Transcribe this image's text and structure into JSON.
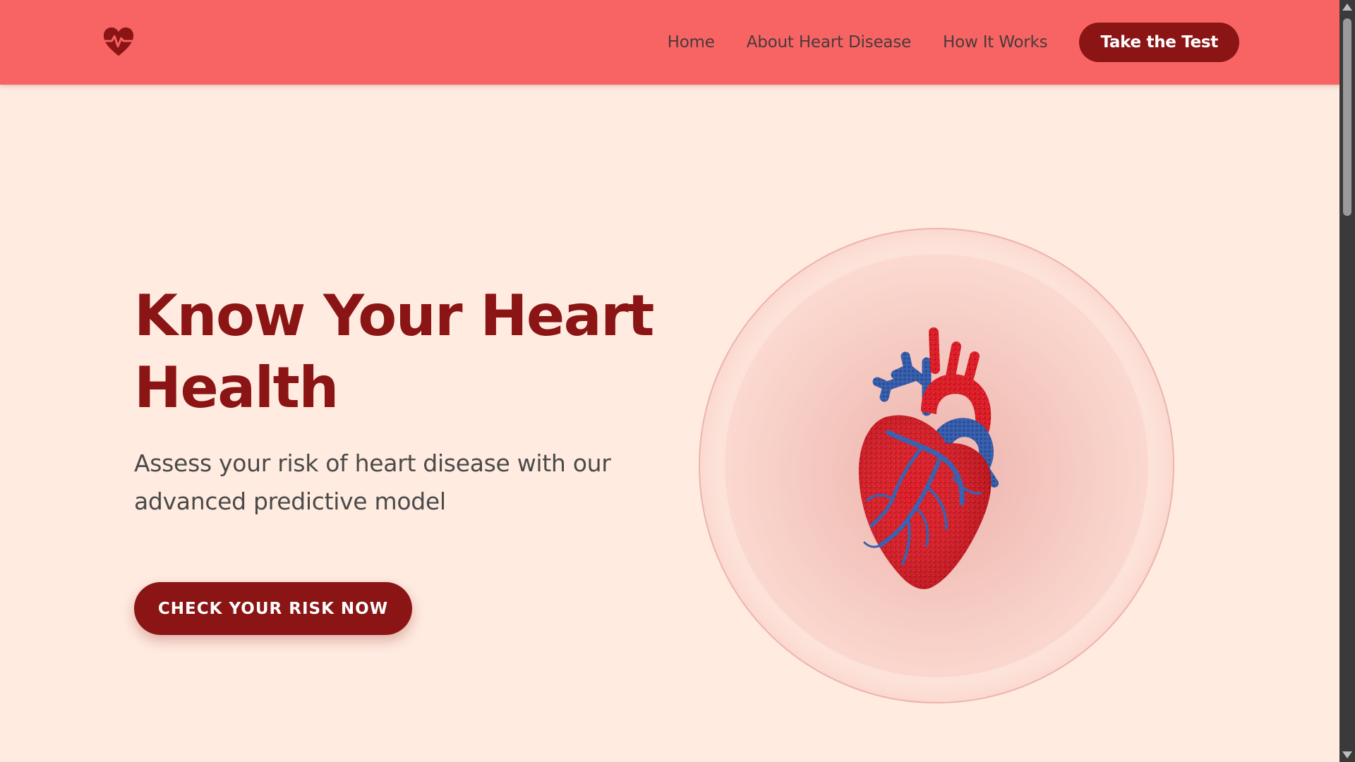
{
  "navbar": {
    "logo_icon": "heart-pulse-icon",
    "links": [
      {
        "label": "Home"
      },
      {
        "label": "About Heart Disease"
      },
      {
        "label": "How It Works"
      }
    ],
    "cta_label": "Take the Test"
  },
  "hero": {
    "title": "Know Your Heart Health",
    "subtitle": "Assess your risk of heart disease with our advanced predictive model",
    "button_label": "CHECK YOUR RISK NOW",
    "image_icon": "anatomical-heart-illustration"
  },
  "colors": {
    "navbar_bg": "#f86464",
    "page_bg": "#ffebe0",
    "brand_dark": "#8b1515",
    "heart_red": "#e0202a",
    "vessel_blue": "#3a62b0"
  }
}
